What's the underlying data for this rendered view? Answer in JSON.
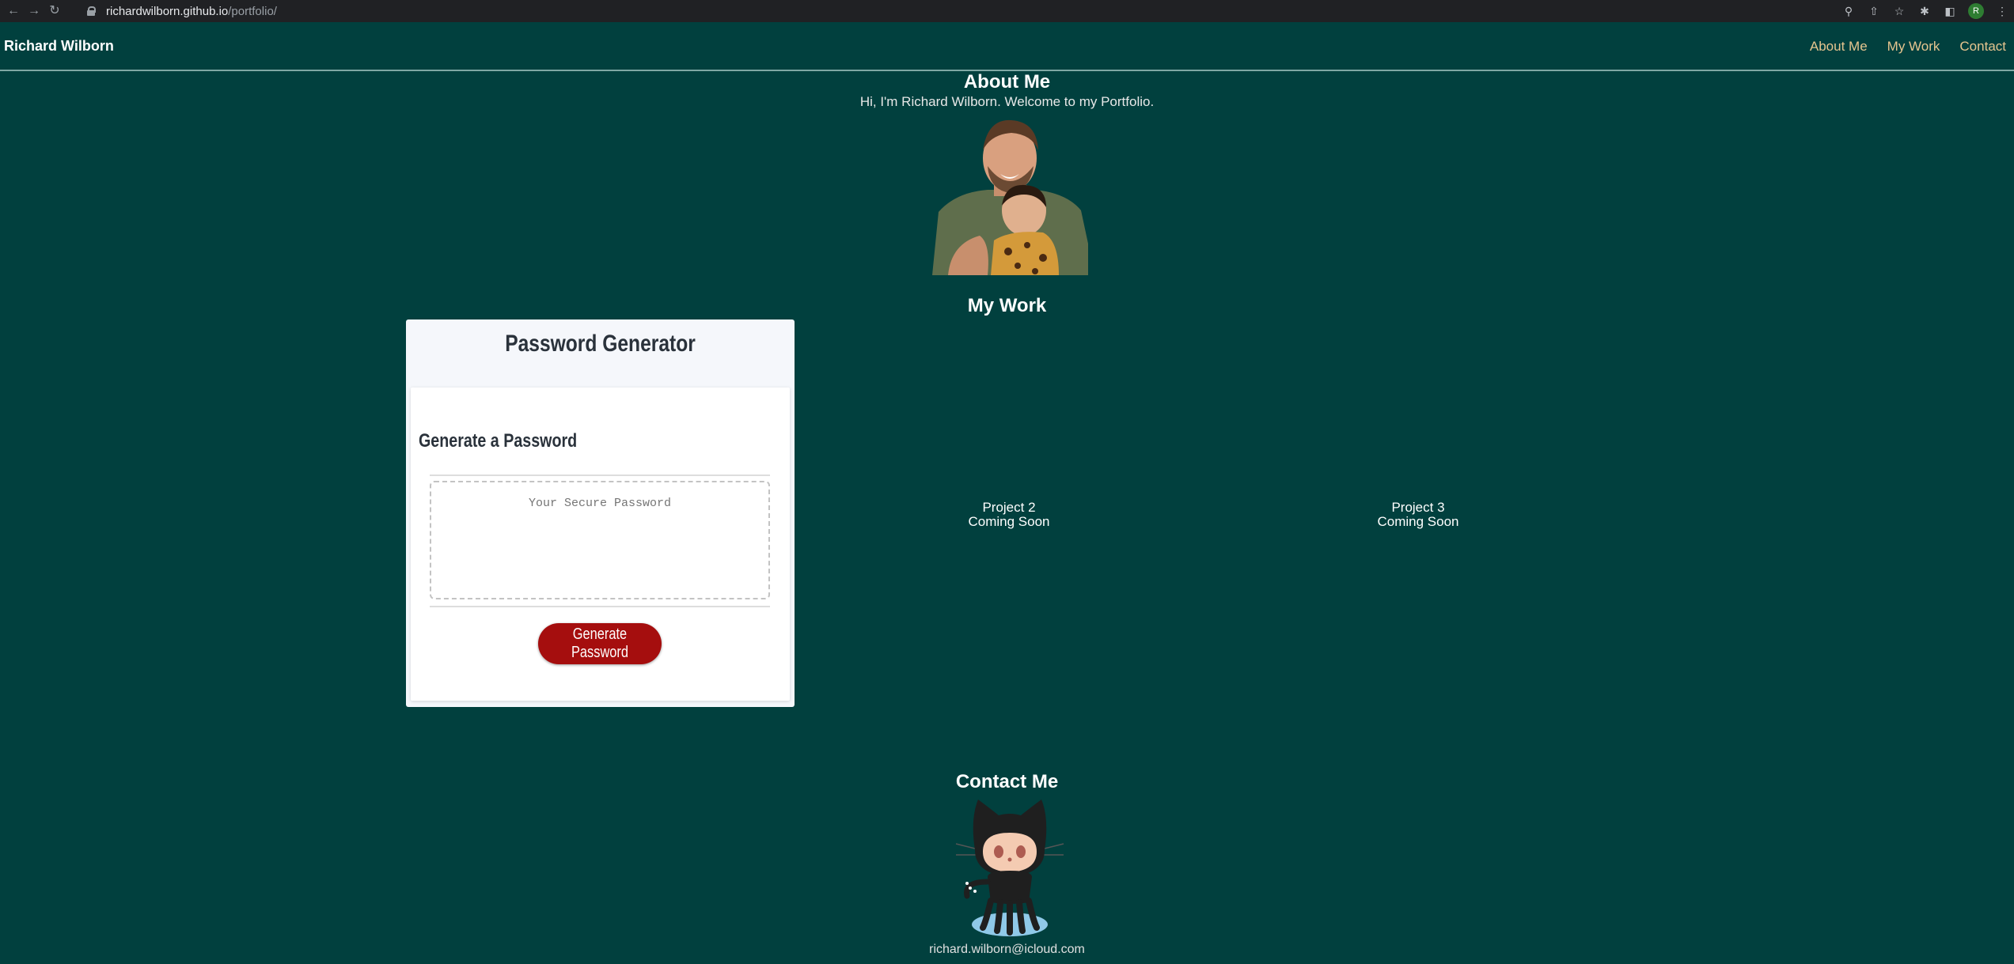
{
  "browser": {
    "url_host": "richardwilborn.github.io",
    "url_path": "/portfolio/",
    "profile_initial": "R"
  },
  "header": {
    "brand": "Richard Wilborn",
    "nav": [
      "About Me",
      "My Work",
      "Contact"
    ]
  },
  "about": {
    "title": "About Me",
    "text": "Hi, I'm Richard Wilborn. Welcome to my Portfolio."
  },
  "work": {
    "title": "My Work",
    "password_generator": {
      "title": "Password Generator",
      "subtitle": "Generate a Password",
      "placeholder": "Your Secure Password",
      "button": "Generate Password"
    },
    "projects": [
      {
        "name": "Project 2",
        "status": "Coming Soon"
      },
      {
        "name": "Project 3",
        "status": "Coming Soon"
      }
    ]
  },
  "contact": {
    "title": "Contact Me",
    "email": "richard.wilborn@icloud.com"
  },
  "colors": {
    "background": "#01403e",
    "nav_link": "#e6c58f",
    "button": "#a50e0e"
  }
}
